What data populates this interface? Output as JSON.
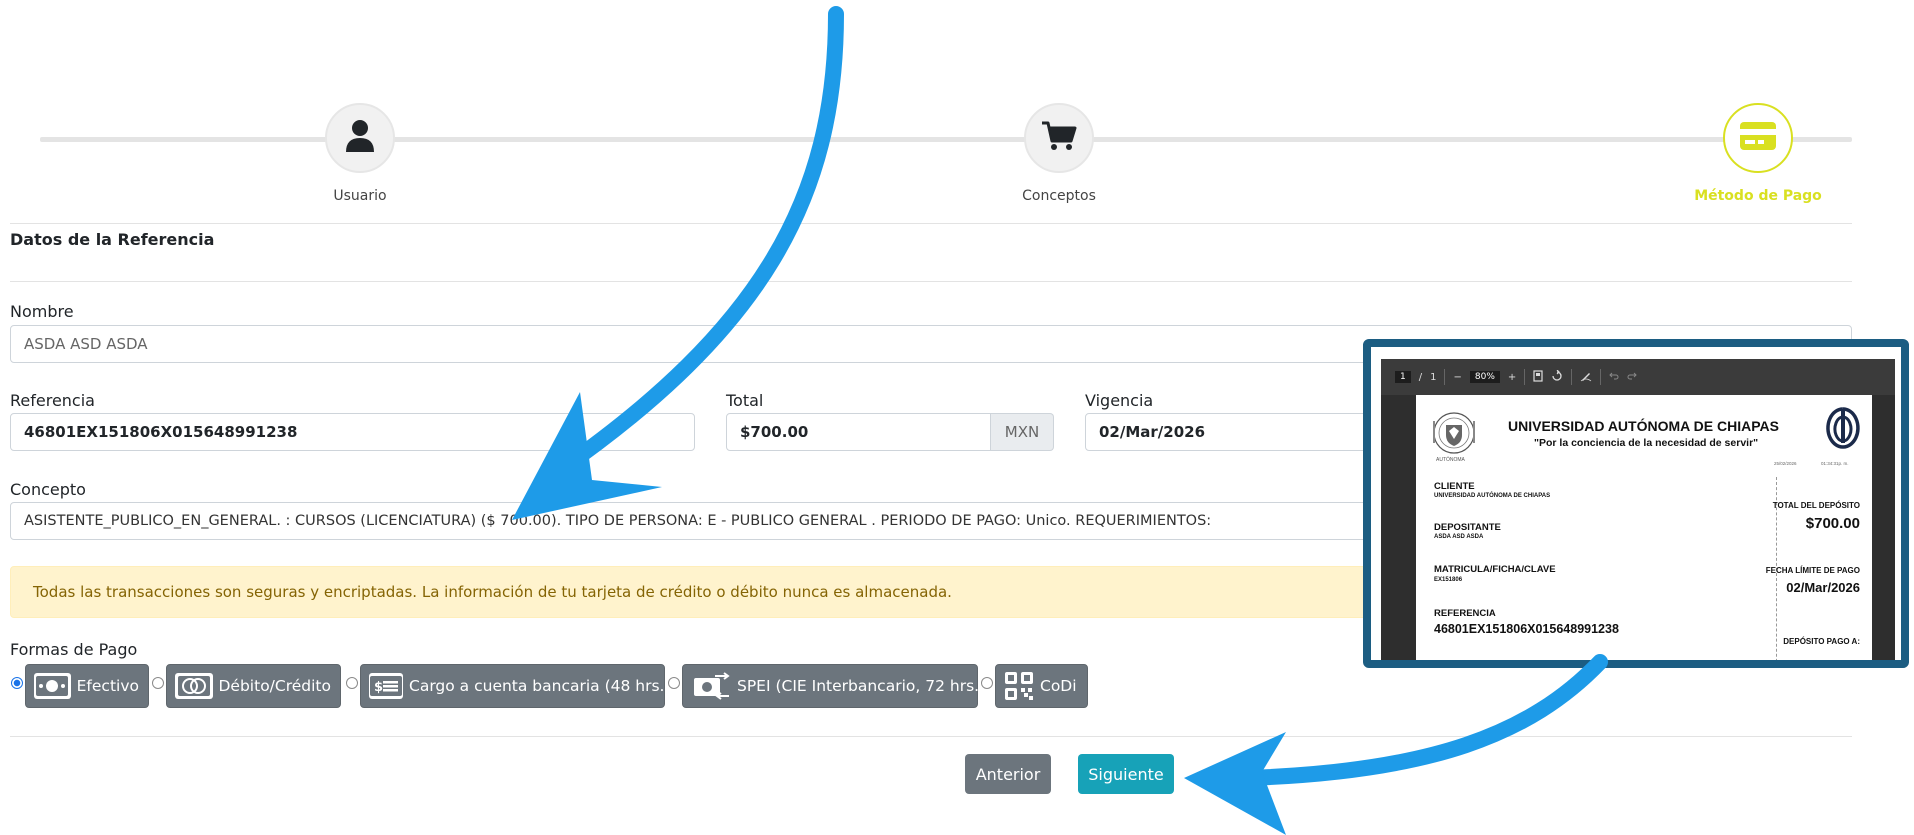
{
  "stepper": {
    "steps": [
      {
        "label": "Usuario",
        "icon": "user-icon"
      },
      {
        "label": "Conceptos",
        "icon": "cart-icon"
      },
      {
        "label": "Método de Pago",
        "icon": "credit-card-icon",
        "active": true
      }
    ]
  },
  "section": {
    "title": "Datos de la Referencia"
  },
  "form": {
    "nombre": {
      "label": "Nombre",
      "value": "ASDA ASD ASDA"
    },
    "referencia": {
      "label": "Referencia",
      "value": "46801EX151806X015648991238"
    },
    "total": {
      "label": "Total",
      "value": "$700.00",
      "currency": "MXN"
    },
    "vigencia": {
      "label": "Vigencia",
      "value": "02/Mar/2026"
    },
    "concepto": {
      "label": "Concepto",
      "value": "ASISTENTE_PUBLICO_EN_GENERAL. : CURSOS (LICENCIATURA) ($ 700.00). TIPO DE PERSONA: E - PUBLICO GENERAL . PERIODO DE PAGO: Unico. REQUERIMIENTOS:"
    }
  },
  "alert": {
    "text": "Todas las transacciones son seguras y encriptadas. La información de tu tarjeta de crédito o débito nunca es almacenada."
  },
  "payment": {
    "label": "Formas de Pago",
    "options": [
      {
        "label": "Efectivo",
        "icon": "cash-icon",
        "selected": true
      },
      {
        "label": "Débito/Crédito",
        "icon": "card-icon",
        "selected": false
      },
      {
        "label": "Cargo a cuenta bancaria (48 hrs.)",
        "icon": "bank-charge-icon",
        "selected": false
      },
      {
        "label": "SPEI (CIE Interbancario, 72 hrs.)",
        "icon": "transfer-icon",
        "selected": false
      },
      {
        "label": "CoDi",
        "icon": "qr-icon",
        "selected": false
      }
    ]
  },
  "nav": {
    "prev": "Anterior",
    "next": "Siguiente"
  },
  "pdf": {
    "toolbar": {
      "page": "1",
      "sep": "/",
      "total_pages": "1",
      "minus": "−",
      "zoom": "80%",
      "plus": "+"
    },
    "header": {
      "university": "UNIVERSIDAD AUTÓNOMA DE CHIAPAS",
      "motto": "\"Por la conciencia de la necesidad de servir\"",
      "date": "25/02/2026",
      "time": "01:34:31p. m.",
      "seal_caption": "AUTÓNOMA"
    },
    "cliente": {
      "label": "CLIENTE",
      "value": "UNIVERSIDAD AUTÓNOMA DE CHIAPAS"
    },
    "depositante": {
      "label": "DEPOSITANTE",
      "value": "ASDA ASD ASDA"
    },
    "matricula": {
      "label": "MATRICULA/FICHA/CLAVE",
      "value": "EX151806"
    },
    "referencia": {
      "label": "REFERENCIA",
      "value": "46801EX151806X015648991238"
    },
    "total_deposito": {
      "label": "TOTAL DEL DEPÓSITO",
      "value": "$700.00"
    },
    "fecha_limite": {
      "label": "FECHA LÍMITE DE PAGO",
      "value": "02/Mar/2026"
    },
    "deposito_pago": {
      "label": "DEPÓSITO PAGO A:"
    }
  },
  "colors": {
    "accent": "#d9e021",
    "annotation_arrow": "#1e9be8",
    "secondary_btn": "#6c757d",
    "primary_btn": "#17a2b8",
    "pdf_frame": "#1c5d82"
  }
}
